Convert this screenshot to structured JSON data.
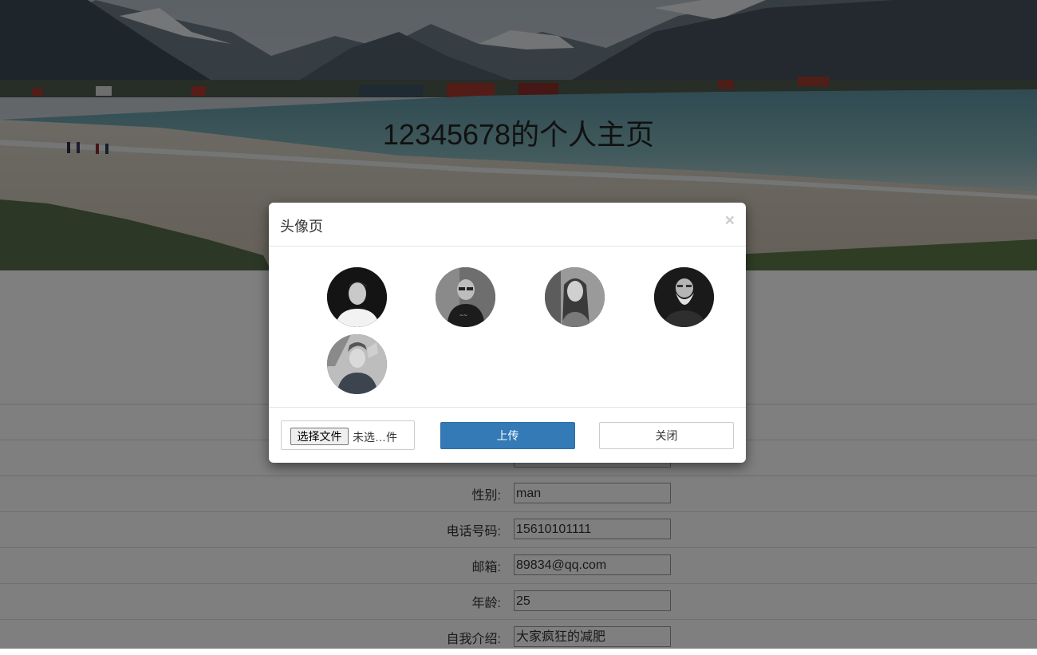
{
  "header": {
    "title": "12345678的个人主页"
  },
  "profile": {
    "rows": [
      {
        "label": "",
        "value": ""
      },
      {
        "label": "",
        "value": ""
      },
      {
        "label": "性别:",
        "value": "man"
      },
      {
        "label": "电话号码:",
        "value": "15610101111"
      },
      {
        "label": "邮箱:",
        "value": "89834@qq.com"
      },
      {
        "label": "年龄:",
        "value": "25"
      },
      {
        "label": "自我介绍:",
        "value": "大家疯狂的减肥"
      }
    ]
  },
  "modal": {
    "title": "头像页",
    "close_icon": "×",
    "avatars": [
      "avatar-1",
      "avatar-2",
      "avatar-3",
      "avatar-4",
      "avatar-5"
    ],
    "file_button": "选择文件",
    "file_status": "未选…件",
    "upload_label": "上传",
    "close_label": "关闭"
  },
  "colors": {
    "primary": "#337ab7",
    "overlay": "rgba(0,0,0,0.5)"
  }
}
